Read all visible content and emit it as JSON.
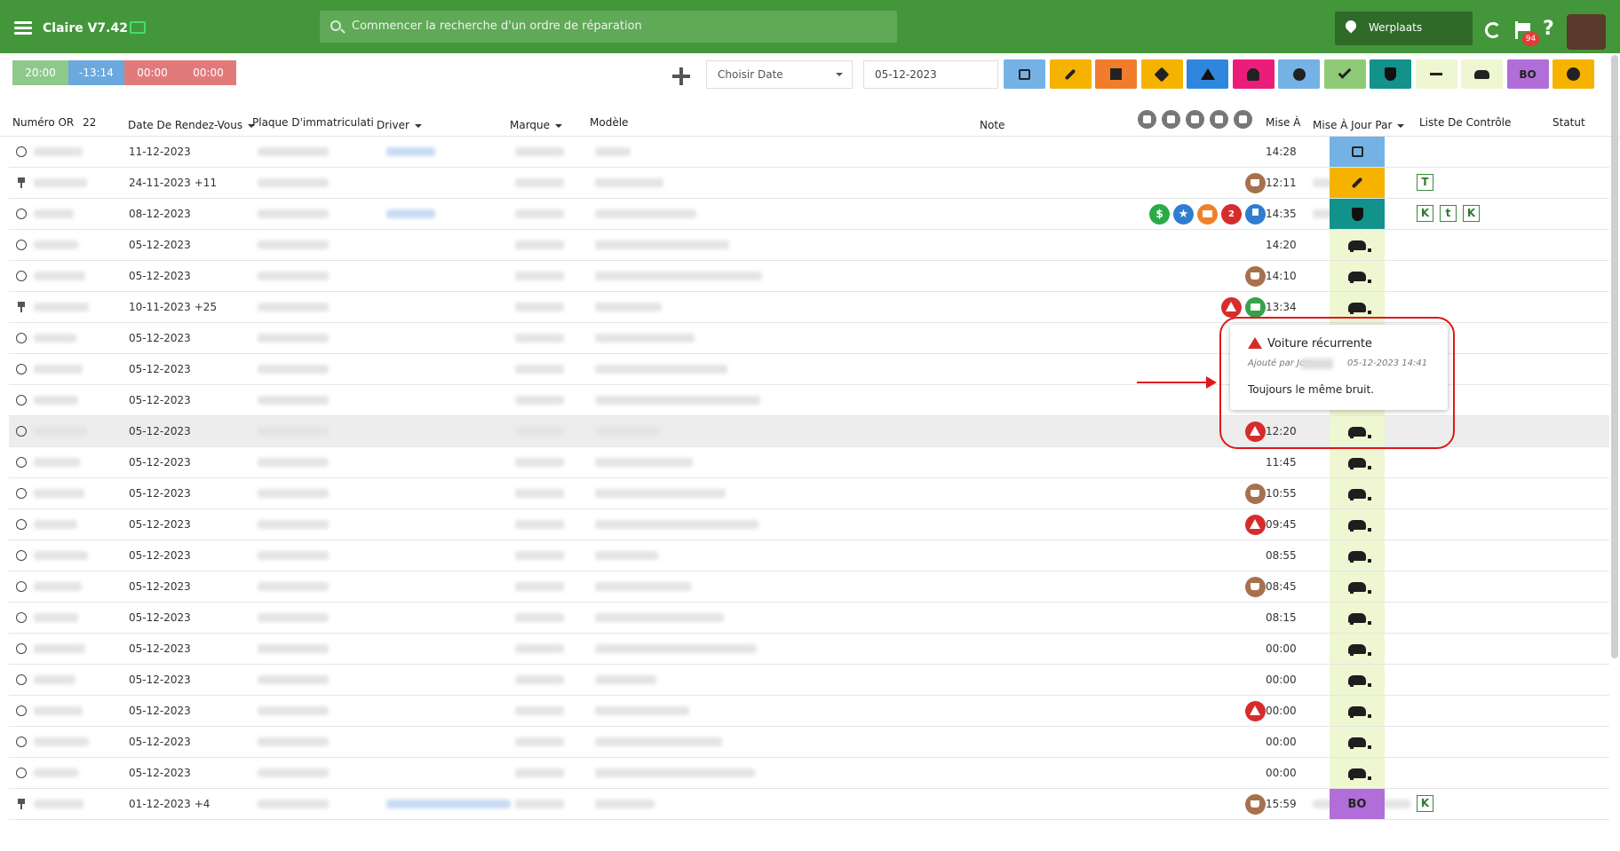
{
  "app": {
    "title": "Claire V7.42",
    "search_placeholder": "Commencer la recherche d'un ordre de réparation",
    "location": "Werplaats",
    "notification_count": "94"
  },
  "timers": [
    {
      "label": "20:00",
      "color": "#8ec98c"
    },
    {
      "label": "-13:14",
      "color": "#6aa8de"
    },
    {
      "label": "00:00",
      "color": "#e17b7b"
    },
    {
      "label": "00:00",
      "color": "#e17b7b"
    }
  ],
  "toolbar": {
    "date_select_label": "Choisir Date",
    "date_value": "05-12-2023"
  },
  "filter_buttons": [
    {
      "name": "calendar",
      "color": "#74b2e6",
      "icon": "box",
      "label": ""
    },
    {
      "name": "wrench",
      "color": "#f5b300",
      "icon": "wrench",
      "label": ""
    },
    {
      "name": "a-label",
      "color": "#f07c2c",
      "icon": "sq",
      "label": ""
    },
    {
      "name": "tag",
      "color": "#f5b300",
      "icon": "tag",
      "label": ""
    },
    {
      "name": "warning",
      "color": "#2e87dd",
      "icon": "tri",
      "label": ""
    },
    {
      "name": "user",
      "color": "#ec1d7a",
      "icon": "person",
      "label": ""
    },
    {
      "name": "smiley",
      "color": "#74b2e6",
      "icon": "circle",
      "label": ""
    },
    {
      "name": "double-check",
      "color": "#8fcb77",
      "icon": "check",
      "label": ""
    },
    {
      "name": "shield",
      "color": "#12928a",
      "icon": "shield",
      "label": ""
    },
    {
      "name": "exit",
      "color": "#eff7d2",
      "icon": "arrow",
      "label": ""
    },
    {
      "name": "car",
      "color": "#eff7d2",
      "icon": "car",
      "label": ""
    },
    {
      "name": "bo",
      "color": "#b16ed8",
      "icon": "",
      "label": "BO"
    },
    {
      "name": "cancel",
      "color": "#f5b300",
      "icon": "xcircle",
      "label": ""
    }
  ],
  "columns": {
    "numero": "Numéro OR",
    "count": "22",
    "date": "Date De Rendez-Vous",
    "plaque": "Plaque D'immatriculati",
    "driver": "Driver",
    "marque": "Marque",
    "modele": "Modèle",
    "note": "Note",
    "mise_a": "Mise À",
    "mise_par": "Mise À Jour Par",
    "liste": "Liste De Contrôle",
    "statut": "Statut"
  },
  "rows": [
    {
      "mark": "radio",
      "date": "11-12-2023",
      "extra": "",
      "time": "14:28",
      "icons": [],
      "checks": [],
      "status": "calendar",
      "status_color": "#74b2e6",
      "driver_blue": true,
      "updater": false
    },
    {
      "mark": "pin",
      "date": "24-11-2023",
      "extra": "+11",
      "time": "12:11",
      "icons": [
        "coffee"
      ],
      "checks": [
        "T"
      ],
      "status": "wrench",
      "status_color": "#f5b300",
      "driver_blue": false,
      "updater": true
    },
    {
      "mark": "radio",
      "date": "08-12-2023",
      "extra": "",
      "time": "14:35",
      "icons": [
        "dollar",
        "star",
        "orange",
        "red",
        "blue"
      ],
      "checks": [
        "K",
        "t",
        "K"
      ],
      "status": "shield",
      "status_color": "#12928a",
      "driver_blue": true,
      "updater": true
    },
    {
      "mark": "radio",
      "date": "05-12-2023",
      "extra": "",
      "time": "14:20",
      "icons": [],
      "checks": [],
      "status": "car",
      "status_color": "#eff7d2",
      "driver_blue": false,
      "updater": false
    },
    {
      "mark": "radio",
      "date": "05-12-2023",
      "extra": "",
      "time": "14:10",
      "icons": [
        "coffee"
      ],
      "checks": [],
      "status": "car",
      "status_color": "#eff7d2",
      "driver_blue": false,
      "updater": false
    },
    {
      "mark": "pin",
      "date": "10-11-2023",
      "extra": "+25",
      "time": "13:34",
      "icons": [
        "warn",
        "cart"
      ],
      "checks": [],
      "status": "car",
      "status_color": "#eff7d2",
      "driver_blue": false,
      "updater": false
    },
    {
      "mark": "radio",
      "date": "05-12-2023",
      "extra": "",
      "time": "",
      "icons": [],
      "checks": [],
      "status": "car",
      "status_color": "#eff7d2",
      "driver_blue": false,
      "updater": false
    },
    {
      "mark": "radio",
      "date": "05-12-2023",
      "extra": "",
      "time": "",
      "icons": [],
      "checks": [],
      "status": "car",
      "status_color": "#eff7d2",
      "driver_blue": false,
      "updater": false
    },
    {
      "mark": "radio",
      "date": "05-12-2023",
      "extra": "",
      "time": "",
      "icons": [],
      "checks": [],
      "status": "car",
      "status_color": "#eff7d2",
      "driver_blue": false,
      "updater": false
    },
    {
      "mark": "radio",
      "date": "05-12-2023",
      "extra": "",
      "time": "12:20",
      "icons": [
        "warn"
      ],
      "checks": [],
      "status": "car",
      "status_color": "#eff7d2",
      "driver_blue": false,
      "updater": false,
      "highlight": true
    },
    {
      "mark": "radio",
      "date": "05-12-2023",
      "extra": "",
      "time": "11:45",
      "icons": [],
      "checks": [],
      "status": "car",
      "status_color": "#eff7d2",
      "driver_blue": false,
      "updater": false
    },
    {
      "mark": "radio",
      "date": "05-12-2023",
      "extra": "",
      "time": "10:55",
      "icons": [
        "coffee"
      ],
      "checks": [],
      "status": "car",
      "status_color": "#eff7d2",
      "driver_blue": false,
      "updater": false
    },
    {
      "mark": "radio",
      "date": "05-12-2023",
      "extra": "",
      "time": "09:45",
      "icons": [
        "warn"
      ],
      "checks": [],
      "status": "car",
      "status_color": "#eff7d2",
      "driver_blue": false,
      "updater": false
    },
    {
      "mark": "radio",
      "date": "05-12-2023",
      "extra": "",
      "time": "08:55",
      "icons": [],
      "checks": [],
      "status": "car",
      "status_color": "#eff7d2",
      "driver_blue": false,
      "updater": false
    },
    {
      "mark": "radio",
      "date": "05-12-2023",
      "extra": "",
      "time": "08:45",
      "icons": [
        "coffee"
      ],
      "checks": [],
      "status": "car",
      "status_color": "#eff7d2",
      "driver_blue": false,
      "updater": false
    },
    {
      "mark": "radio",
      "date": "05-12-2023",
      "extra": "",
      "time": "08:15",
      "icons": [],
      "checks": [],
      "status": "car",
      "status_color": "#eff7d2",
      "driver_blue": false,
      "updater": false
    },
    {
      "mark": "radio",
      "date": "05-12-2023",
      "extra": "",
      "time": "00:00",
      "icons": [],
      "checks": [],
      "status": "car",
      "status_color": "#eff7d2",
      "driver_blue": false,
      "updater": false
    },
    {
      "mark": "radio",
      "date": "05-12-2023",
      "extra": "",
      "time": "00:00",
      "icons": [],
      "checks": [],
      "status": "car",
      "status_color": "#eff7d2",
      "driver_blue": false,
      "updater": false
    },
    {
      "mark": "radio",
      "date": "05-12-2023",
      "extra": "",
      "time": "00:00",
      "icons": [
        "warn"
      ],
      "checks": [],
      "status": "car",
      "status_color": "#eff7d2",
      "driver_blue": false,
      "updater": false
    },
    {
      "mark": "radio",
      "date": "05-12-2023",
      "extra": "",
      "time": "00:00",
      "icons": [],
      "checks": [],
      "status": "car",
      "status_color": "#eff7d2",
      "driver_blue": false,
      "updater": false
    },
    {
      "mark": "radio",
      "date": "05-12-2023",
      "extra": "",
      "time": "00:00",
      "icons": [],
      "checks": [],
      "status": "car",
      "status_color": "#eff7d2",
      "driver_blue": false,
      "updater": false
    },
    {
      "mark": "pin",
      "date": "01-12-2023",
      "extra": "+4",
      "time": "15:59",
      "icons": [
        "coffee"
      ],
      "checks": [
        "K"
      ],
      "status": "bo",
      "status_label": "BO",
      "status_color": "#b16ed8",
      "driver_blue": true,
      "updater": true
    }
  ],
  "row_badges": {
    "red_count": "2"
  },
  "popup": {
    "title": "Voiture récurrente",
    "added_by": "Ajouté par Joe",
    "timestamp": "05-12-2023 14:41",
    "body": "Toujours le même bruit."
  }
}
